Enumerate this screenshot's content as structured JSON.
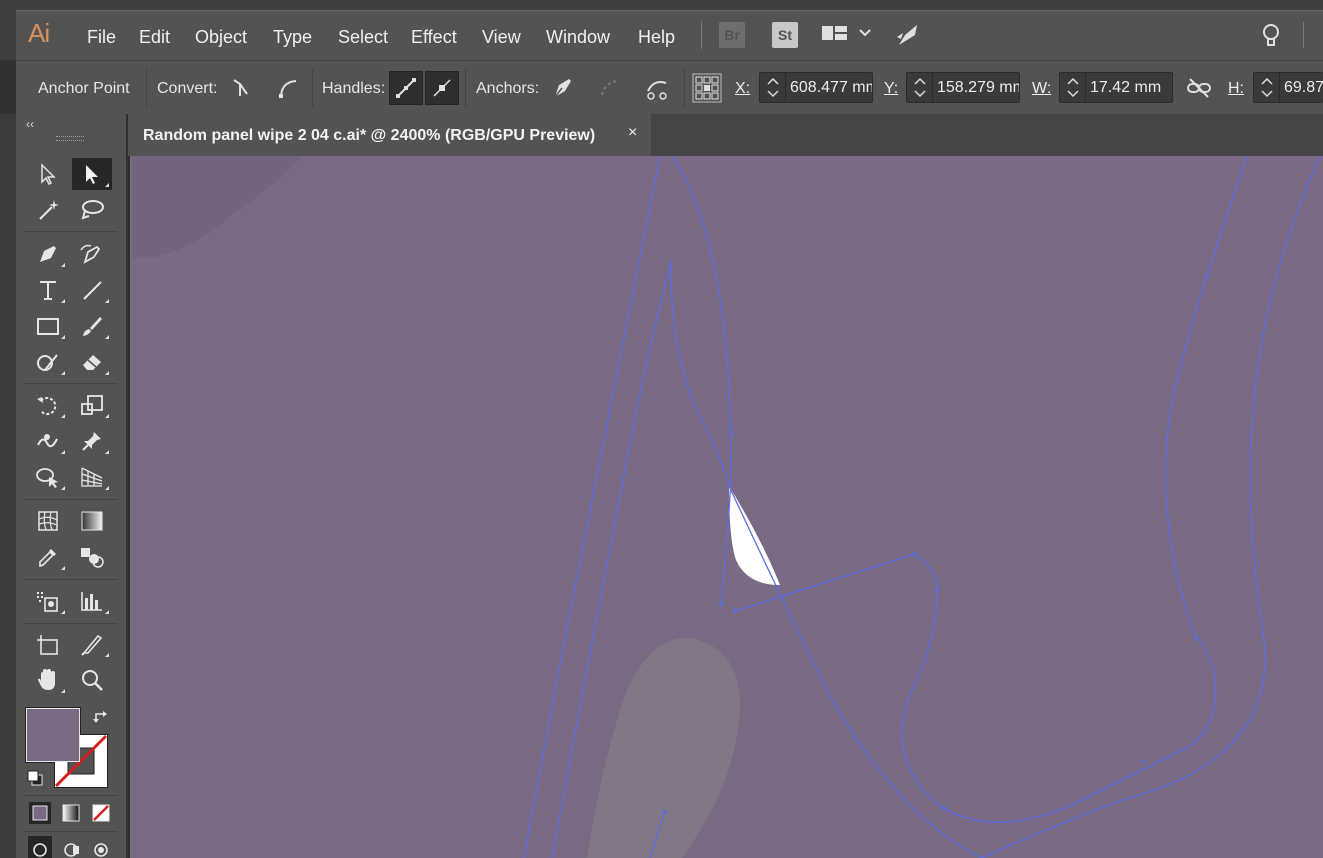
{
  "app": {
    "logo": "Ai"
  },
  "menu": [
    "File",
    "Edit",
    "Object",
    "Type",
    "Select",
    "Effect",
    "View",
    "Window",
    "Help"
  ],
  "menu_badges": {
    "bridge": "Br",
    "stock": "St"
  },
  "control_bar": {
    "mode_label": "Anchor Point",
    "convert_label": "Convert:",
    "handles_label": "Handles:",
    "anchors_label": "Anchors:",
    "x_label": "X:",
    "x_value": "608.477 mm",
    "y_label": "Y:",
    "y_value": "158.279 mm",
    "w_label": "W:",
    "w_value": "17.42 mm",
    "h_label": "H:",
    "h_value": "69.87"
  },
  "document": {
    "tab_title": "Random panel wipe 2 04 c.ai* @ 2400% (RGB/GPU Preview)",
    "close_glyph": "×"
  },
  "tools_panel": {
    "collapse_glyph": "‹‹"
  },
  "colors": {
    "canvas_fill": "#7a6a84",
    "path_stroke": "#5a6ee6",
    "fill_swatch": "#7a6a84",
    "ui_panel": "#535353"
  }
}
